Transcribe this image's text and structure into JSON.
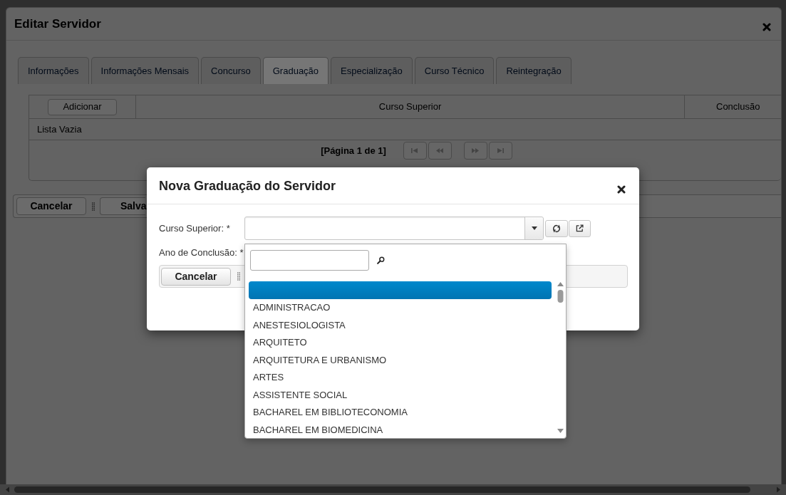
{
  "background_window": {
    "title": "Editar Servidor",
    "tabs": [
      {
        "label": "Informações",
        "selected": false
      },
      {
        "label": "Informações Mensais",
        "selected": false
      },
      {
        "label": "Concurso",
        "selected": false
      },
      {
        "label": "Graduação",
        "selected": true
      },
      {
        "label": "Especialização",
        "selected": false
      },
      {
        "label": "Curso Técnico",
        "selected": false
      },
      {
        "label": "Reintegração",
        "selected": false
      }
    ],
    "table": {
      "add_button": "Adicionar",
      "columns": [
        "Curso Superior",
        "Conclusão"
      ],
      "empty_message": "Lista Vazia",
      "page_info": "[Página 1 de 1]",
      "pager_buttons": [
        {
          "kind": "first",
          "disabled": true
        },
        {
          "kind": "previous",
          "disabled": true
        },
        {
          "kind": "next",
          "disabled": true
        },
        {
          "kind": "last",
          "disabled": true
        }
      ]
    },
    "buttons": [
      "Cancelar",
      "Salva"
    ]
  },
  "dialog": {
    "title": "Nova Graduação do Servidor",
    "fields": [
      {
        "label": "Curso Superior: *",
        "kind": "select"
      },
      {
        "label": "Ano de Conclusão: *",
        "kind": "text"
      }
    ],
    "buttons": [
      "Cancelar"
    ]
  },
  "dropdown": {
    "options": [
      {
        "selected": true
      },
      {
        "label": "ADMINISTRACAO",
        "selected": false
      },
      {
        "label": "ANESTESIOLOGISTA",
        "selected": false
      },
      {
        "label": "ARQUITETO",
        "selected": false
      },
      {
        "label": "ARQUITETURA E URBANISMO",
        "selected": false
      },
      {
        "label": "ARTES",
        "selected": false
      },
      {
        "label": "ASSISTENTE SOCIAL",
        "selected": false
      },
      {
        "label": "BACHAREL EM BIBLIOTECONOMIA",
        "selected": false
      },
      {
        "label": "BACHAREL EM BIOMEDICINA",
        "selected": false
      }
    ]
  }
}
